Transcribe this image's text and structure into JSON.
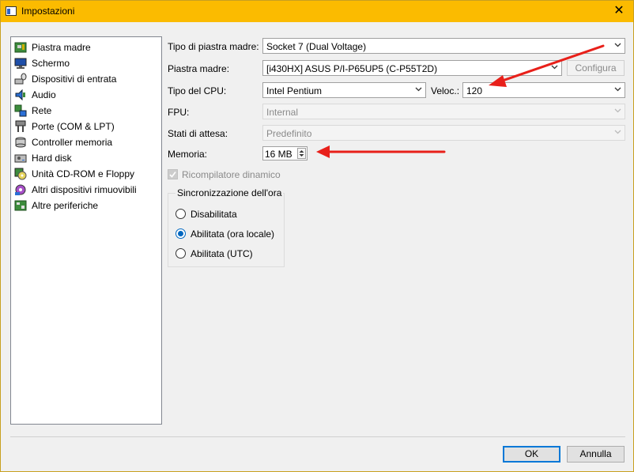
{
  "window": {
    "title": "Impostazioni",
    "close_icon": "close-icon"
  },
  "sidebar": {
    "items": [
      {
        "label": "Piastra madre",
        "icon": "motherboard-icon"
      },
      {
        "label": "Schermo",
        "icon": "display-icon"
      },
      {
        "label": "Dispositivi di entrata",
        "icon": "input-devices-icon"
      },
      {
        "label": "Audio",
        "icon": "audio-icon"
      },
      {
        "label": "Rete",
        "icon": "network-icon"
      },
      {
        "label": "Porte (COM & LPT)",
        "icon": "ports-icon"
      },
      {
        "label": "Controller memoria",
        "icon": "storage-controller-icon"
      },
      {
        "label": "Hard disk",
        "icon": "hard-disk-icon"
      },
      {
        "label": "Unità CD-ROM e Floppy",
        "icon": "cdrom-floppy-icon"
      },
      {
        "label": "Altri dispositivi rimuovibili",
        "icon": "removable-devices-icon"
      },
      {
        "label": "Altre periferiche",
        "icon": "other-peripherals-icon"
      }
    ]
  },
  "machine": {
    "type_label": "Tipo di piastra madre:",
    "type_value": "Socket 7 (Dual Voltage)",
    "board_label": "Piastra madre:",
    "board_value": "[i430HX] ASUS P/I-P65UP5 (C-P55T2D)",
    "configure_label": "Configura",
    "cpu_label": "Tipo del CPU:",
    "cpu_value": "Intel Pentium",
    "speed_label": "Veloc.:",
    "speed_value": "120",
    "fpu_label": "FPU:",
    "fpu_value": "Internal",
    "wait_label": "Stati di attesa:",
    "wait_value": "Predefinito",
    "memory_label": "Memoria:",
    "memory_value": "16 MB",
    "dynarec_label": "Ricompilatore dinamico",
    "time_sync": {
      "title": "Sincronizzazione dell'ora",
      "options": [
        "Disabilitata",
        "Abilitata (ora locale)",
        "Abilitata (UTC)"
      ],
      "selected_index": 1
    }
  },
  "footer": {
    "ok_label": "OK",
    "cancel_label": "Annulla"
  },
  "colors": {
    "titlebar": "#fbbb00",
    "accent": "#0067c0",
    "annotation_arrow": "#e8201a"
  }
}
